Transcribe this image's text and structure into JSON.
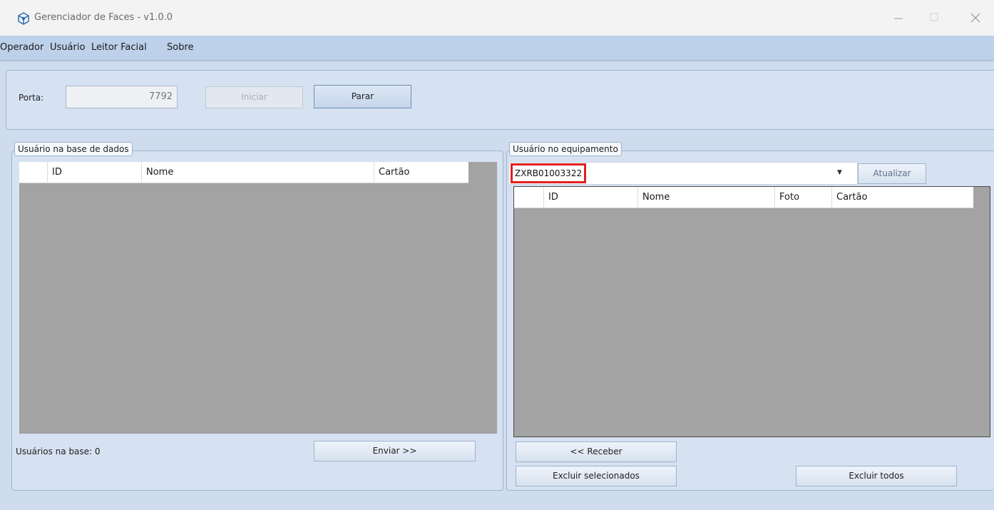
{
  "window": {
    "title": "Gerenciador de Faces - v1.0.0",
    "controls": {
      "minimize_icon": "minimize-icon",
      "maximize_icon": "maximize-icon",
      "close_icon": "close-icon"
    }
  },
  "menu": {
    "items": [
      {
        "label": "Operador"
      },
      {
        "label": "Usuário"
      },
      {
        "label": "Leitor Facial"
      },
      {
        "label": "Sobre"
      }
    ]
  },
  "server": {
    "port_label": "Porta:",
    "port_value": "7792",
    "start_label": "Iniciar",
    "stop_label": "Parar"
  },
  "database": {
    "caption": "Usuário na base de dados",
    "columns": [
      "ID",
      "Nome",
      "Cartão"
    ],
    "count_text": "Usuários na base: 0",
    "send_label": "Enviar >>"
  },
  "device": {
    "caption": "Usuário no equipamento",
    "selected": "ZXRB01003322",
    "refresh_label": "Atualizar",
    "columns": [
      "ID",
      "Nome",
      "Foto",
      "Cartão"
    ],
    "receive_label": "<< Receber",
    "delete_selected_label": "Excluir selecionados",
    "delete_all_label": "Excluir todos"
  },
  "colors": {
    "menubar": "#bed1ea",
    "grid_background": "#a3a3a3",
    "highlight_box": "#e02020"
  }
}
